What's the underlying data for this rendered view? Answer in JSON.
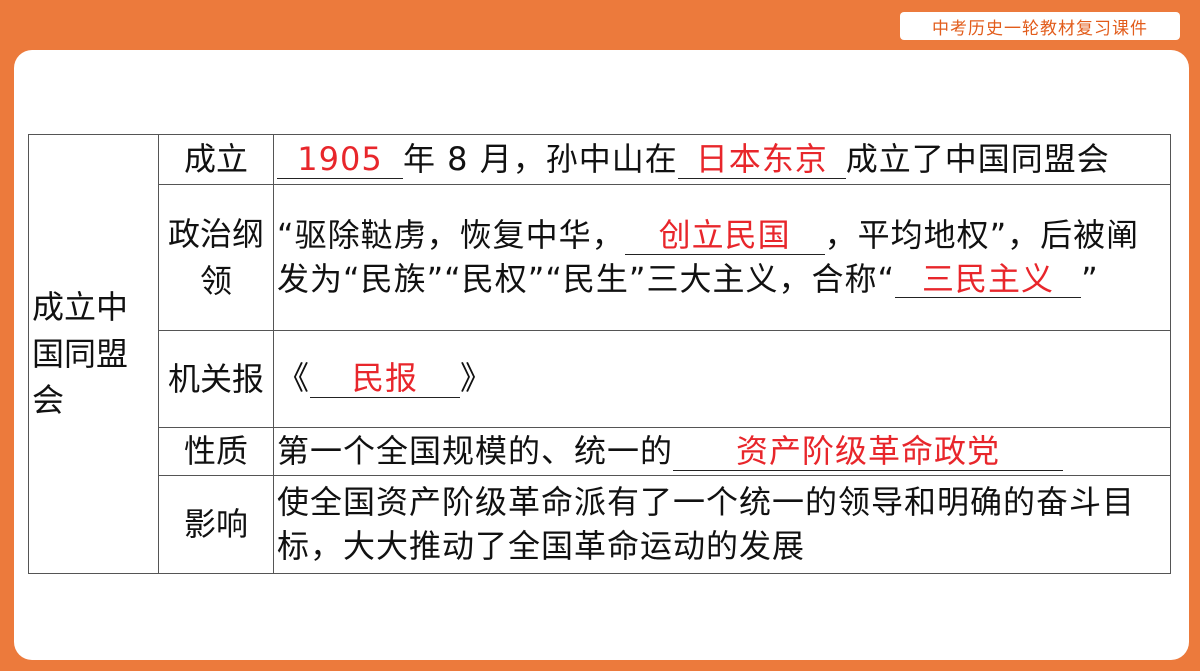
{
  "header": {
    "course_label": "中考历史一轮教材复习课件"
  },
  "table": {
    "topic": "成立中国同盟会",
    "rows": {
      "founding": {
        "head": "成立",
        "answer_year": "1905",
        "text_a": "年 8 月，孙中山在",
        "answer_place": "日本东京",
        "text_b": "成立了中国同盟会"
      },
      "platform": {
        "head": "政治纲领",
        "text_a": "“驱除鞑虏，恢复中华，",
        "answer_slogan": "创立民国",
        "text_b": "，平均地权”，后被阐发为“民族”“民权”“民生”三大主义，合称“",
        "answer_doctrine": "三民主义",
        "text_c": "”"
      },
      "newspaper": {
        "head": "机关报",
        "text_a": "《",
        "answer_paper": "民报",
        "text_b": "》"
      },
      "nature": {
        "head": "性质",
        "text_a": "第一个全国规模的、统一的",
        "answer_party": "资产阶级革命政党"
      },
      "impact": {
        "head": "影响",
        "text": "使全国资产阶级革命派有了一个统一的领导和明确的奋斗目标，大大推动了全国革命运动的发展"
      }
    }
  },
  "colors": {
    "background": "#ec7a3c",
    "answer": "#e8262b",
    "badge_text": "#e25c1b"
  }
}
